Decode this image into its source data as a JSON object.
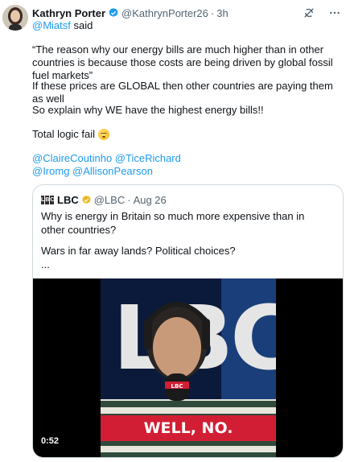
{
  "tweet": {
    "author_name": "Kathryn Porter",
    "author_handle": "@KathrynPorter26",
    "time": "3h",
    "separator": "·",
    "reply_mention": "@Miatsf",
    "reply_suffix": " said",
    "paragraphs": [
      "“The reason why our energy bills are much higher than in other countries is because those costs are being driven by global fossil fuel markets”",
      "If these prices are GLOBAL then other countries are paying them as well",
      "So explain why WE have the highest energy bills!!",
      "Total logic fail"
    ],
    "mentions_line1": "@ClaireCoutinho @TiceRichard",
    "mentions_line2": "@Iromg @AllisonPearson",
    "icons": [
      "verified-badge-icon",
      "grok-icon",
      "more-options-icon",
      "thinking-face-emoji"
    ]
  },
  "quote": {
    "name": "LBC",
    "handle": "@LBC",
    "separator": "·",
    "date": "Aug 26",
    "logo_letters": [
      "L",
      "B",
      "C"
    ],
    "text_line1": "Why is energy in Britain so much more expensive than in other countries?",
    "text_line2": "Wars in far away lands? Political choices?",
    "text_line3": "...",
    "video": {
      "duration": "0:52",
      "banner_text": "WELL, NO.",
      "mic_logo": "LBC",
      "backdrop_text": "LBC"
    }
  },
  "colors": {
    "link": "#1d9bf0",
    "muted": "#536471",
    "text": "#0f1419",
    "banner_red": "#d21e34",
    "verified_blue": "#1d9bf0",
    "gold_badge": "#e8b923"
  }
}
